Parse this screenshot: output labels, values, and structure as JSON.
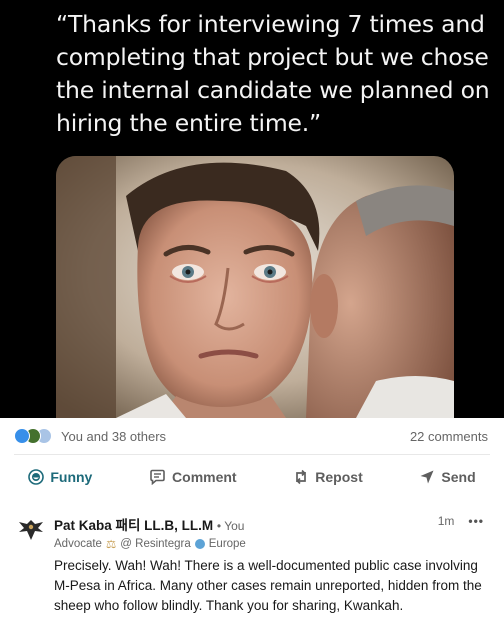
{
  "meme": {
    "caption": "“Thanks for interviewing 7 times and completing that project but we chose the internal candidate we planned on hiring the entire time.”"
  },
  "reactions": {
    "icons": [
      "like-reaction-icon",
      "celebrate-reaction-icon",
      "funny-reaction-icon"
    ],
    "summary": "You and 38 others",
    "comments_count": "22 comments"
  },
  "actions": [
    {
      "label": "Funny",
      "icon": "funny-face-icon",
      "active": true
    },
    {
      "label": "Comment",
      "icon": "comment-bubble-icon"
    },
    {
      "label": "Repost",
      "icon": "repost-arrows-icon"
    },
    {
      "label": "Send",
      "icon": "send-plane-icon"
    }
  ],
  "comment": {
    "author": "Pat Kaba 패티 LL.B, LL.M",
    "author_tag": "• You",
    "headline_role": "Advocate",
    "headline_org": "@ Resintegra",
    "headline_location": "Europe",
    "time": "1m",
    "more": "•••",
    "body": "Precisely. Wah! Wah! There is a well-documented public case involving M-Pesa in Africa. Many other cases remain unreported, hidden from the sheep who follow blindly. Thank you for sharing, Kwankah."
  },
  "colors": {
    "accent_active": "#1d6a7a",
    "meme_bg": "#000000",
    "meme_text": "#f4f4f4",
    "muted_text": "#666666"
  }
}
